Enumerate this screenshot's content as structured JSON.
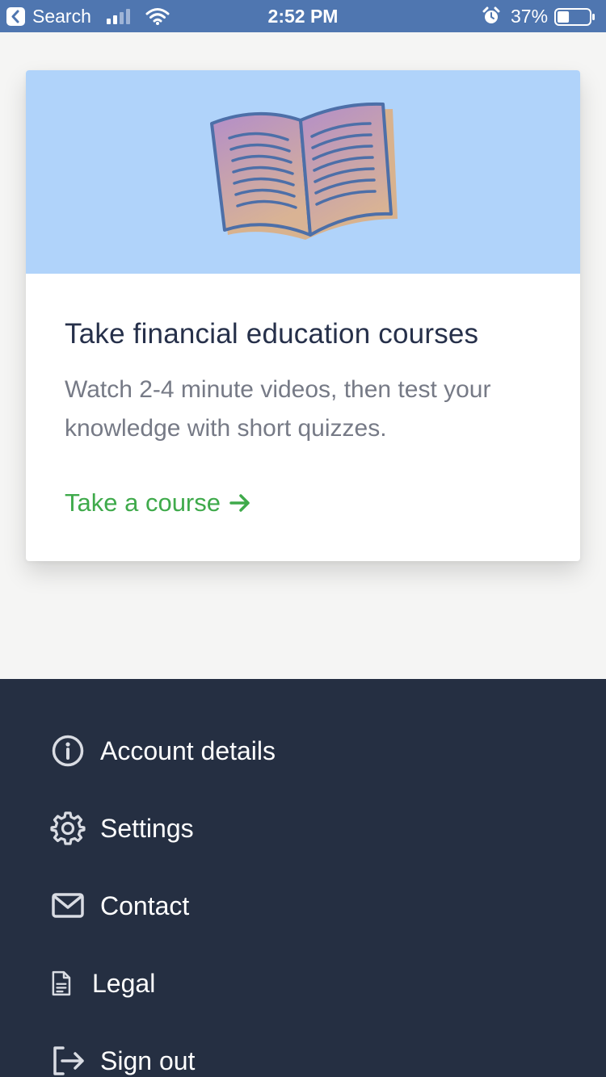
{
  "status_bar": {
    "back_app": "Search",
    "time": "2:52 PM",
    "battery_percent": "37%",
    "battery_level": 0.37
  },
  "card": {
    "illustration": "open-book-icon",
    "title": "Take financial education courses",
    "description": "Watch 2-4 minute videos, then test your knowledge with short quizzes.",
    "link_label": "Take a course",
    "colors": {
      "hero_bg": "#b0d3fa",
      "link": "#3faa4b"
    }
  },
  "menu": {
    "items": [
      {
        "label": "Account details",
        "icon": "info-icon"
      },
      {
        "label": "Settings",
        "icon": "gear-icon"
      },
      {
        "label": "Contact",
        "icon": "mail-icon"
      },
      {
        "label": "Legal",
        "icon": "document-icon"
      },
      {
        "label": "Sign out",
        "icon": "sign-out-icon"
      }
    ],
    "background": "#252f42"
  }
}
